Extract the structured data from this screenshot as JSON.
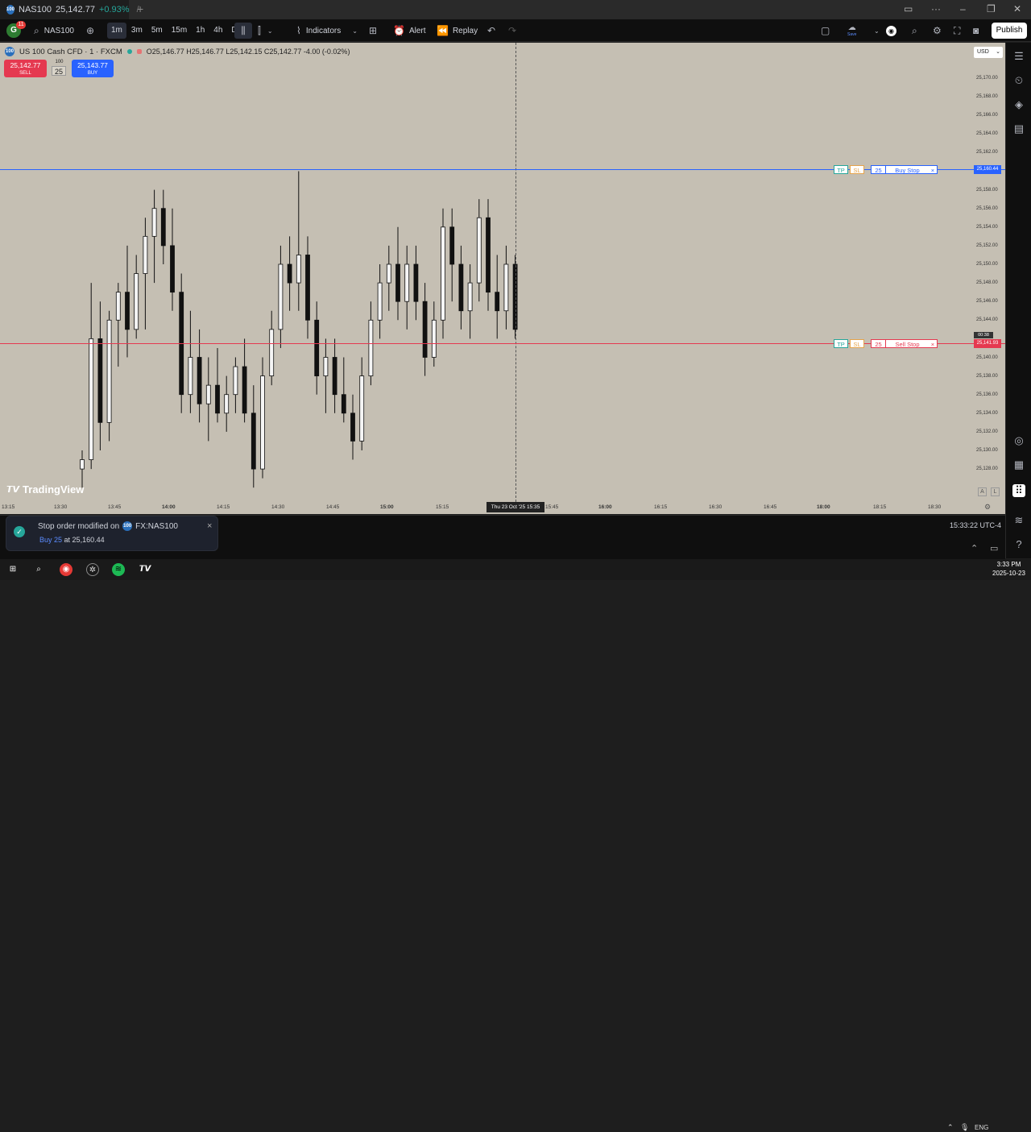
{
  "tab": {
    "symbol": "NAS100",
    "price": "25,142.77",
    "change": "+0.93%",
    "close": "/",
    "logo": "100",
    "new_tab": "+"
  },
  "toolbar": {
    "avatar_letter": "G",
    "avatar_badge": "11",
    "symbol": "NAS100",
    "intervals": [
      "1m",
      "3m",
      "5m",
      "15m",
      "1h",
      "4h",
      "D"
    ],
    "indicators_label": "Indicators",
    "alert_label": "Alert",
    "replay_label": "Replay",
    "save_label": "Save",
    "publish_label": "Publish"
  },
  "legend": {
    "title": "US 100 Cash CFD · 1 · FXCM",
    "ohlc": "O25,146.77 H25,146.77 L25,142.15 C25,142.77 -4.00 (-0.02%)"
  },
  "trade": {
    "sell_price": "25,142.77",
    "sell_label": "SELL",
    "buy_price": "25,143.77",
    "buy_label": "BUY",
    "spread": "100",
    "quantity": "25"
  },
  "currency": "USD",
  "orders": {
    "buy_stop": {
      "tp": "TP",
      "sl": "SL",
      "qty": "25",
      "label": "Buy Stop",
      "close": "×",
      "price_tag": "25,160.44",
      "color": "#2962ff"
    },
    "sell_stop": {
      "tp": "TP",
      "sl": "SL",
      "qty": "25",
      "label": "Sell Stop",
      "close": "×",
      "price_tag": "25,141.93",
      "countdown": "00:38",
      "color": "#e53950"
    }
  },
  "price_axis": {
    "labels": [
      "25,170.00",
      "25,168.00",
      "25,166.00",
      "25,164.00",
      "25,162.00",
      "25,158.00",
      "25,156.00",
      "25,154.00",
      "25,152.00",
      "25,150.00",
      "25,148.00",
      "25,146.00",
      "25,144.00",
      "25,140.00",
      "25,138.00",
      "25,136.00",
      "25,134.00",
      "25,132.00",
      "25,130.00",
      "25,128.00"
    ]
  },
  "time_axis": {
    "labels": [
      "13:15",
      "13:30",
      "13:45",
      "14:00",
      "14:15",
      "14:30",
      "14:45",
      "15:00",
      "15:15",
      "15:45",
      "16:00",
      "16:15",
      "16:30",
      "16:45",
      "18:00",
      "18:15",
      "18:30"
    ],
    "crosshair": "Thu 23 Oct '25  15:35"
  },
  "watermark": "TradingView",
  "status_clock": "15:33:22 UTC-4",
  "toast": {
    "title": "Stop order modified on",
    "symbol": "FX:NAS100",
    "side_qty": "Buy 25",
    "detail": "at 25,160.44",
    "close": "×"
  },
  "taskbar": {
    "lang": "ENG",
    "time": "3:33 PM",
    "date": "2025-10-23"
  },
  "chart_data": {
    "type": "candlestick",
    "symbol": "US 100 Cash CFD",
    "ylim": [
      25126,
      25172
    ],
    "candles": [
      {
        "o": 25128,
        "h": 25130,
        "l": 25126,
        "c": 25129
      },
      {
        "o": 25129,
        "h": 25148,
        "l": 25128,
        "c": 25142
      },
      {
        "o": 25142,
        "h": 25146,
        "l": 25130,
        "c": 25133
      },
      {
        "o": 25133,
        "h": 25145,
        "l": 25131,
        "c": 25144
      },
      {
        "o": 25144,
        "h": 25148,
        "l": 25139,
        "c": 25147
      },
      {
        "o": 25147,
        "h": 25152,
        "l": 25140,
        "c": 25143
      },
      {
        "o": 25143,
        "h": 25151,
        "l": 25142,
        "c": 25149
      },
      {
        "o": 25149,
        "h": 25155,
        "l": 25143,
        "c": 25153
      },
      {
        "o": 25153,
        "h": 25158,
        "l": 25148,
        "c": 25156
      },
      {
        "o": 25156,
        "h": 25158,
        "l": 25150,
        "c": 25152
      },
      {
        "o": 25152,
        "h": 25156,
        "l": 25145,
        "c": 25147
      },
      {
        "o": 25147,
        "h": 25149,
        "l": 25134,
        "c": 25136
      },
      {
        "o": 25136,
        "h": 25145,
        "l": 25134,
        "c": 25140
      },
      {
        "o": 25140,
        "h": 25143,
        "l": 25133,
        "c": 25135
      },
      {
        "o": 25135,
        "h": 25140,
        "l": 25131,
        "c": 25137
      },
      {
        "o": 25137,
        "h": 25141,
        "l": 25133,
        "c": 25134
      },
      {
        "o": 25134,
        "h": 25138,
        "l": 25132,
        "c": 25136
      },
      {
        "o": 25136,
        "h": 25140,
        "l": 25134,
        "c": 25139
      },
      {
        "o": 25139,
        "h": 25142,
        "l": 25133,
        "c": 25134
      },
      {
        "o": 25134,
        "h": 25137,
        "l": 25126,
        "c": 25128
      },
      {
        "o": 25128,
        "h": 25140,
        "l": 25127,
        "c": 25138
      },
      {
        "o": 25138,
        "h": 25145,
        "l": 25137,
        "c": 25143
      },
      {
        "o": 25143,
        "h": 25152,
        "l": 25141,
        "c": 25150
      },
      {
        "o": 25150,
        "h": 25153,
        "l": 25145,
        "c": 25148
      },
      {
        "o": 25148,
        "h": 25160,
        "l": 25145,
        "c": 25151
      },
      {
        "o": 25151,
        "h": 25153,
        "l": 25142,
        "c": 25144
      },
      {
        "o": 25144,
        "h": 25146,
        "l": 25136,
        "c": 25138
      },
      {
        "o": 25138,
        "h": 25142,
        "l": 25134,
        "c": 25140
      },
      {
        "o": 25140,
        "h": 25142,
        "l": 25134,
        "c": 25136
      },
      {
        "o": 25136,
        "h": 25140,
        "l": 25133,
        "c": 25134
      },
      {
        "o": 25134,
        "h": 25136,
        "l": 25129,
        "c": 25131
      },
      {
        "o": 25131,
        "h": 25140,
        "l": 25130,
        "c": 25138
      },
      {
        "o": 25138,
        "h": 25146,
        "l": 25137,
        "c": 25144
      },
      {
        "o": 25144,
        "h": 25150,
        "l": 25142,
        "c": 25148
      },
      {
        "o": 25148,
        "h": 25152,
        "l": 25145,
        "c": 25150
      },
      {
        "o": 25150,
        "h": 25154,
        "l": 25144,
        "c": 25146
      },
      {
        "o": 25146,
        "h": 25152,
        "l": 25143,
        "c": 25150
      },
      {
        "o": 25150,
        "h": 25152,
        "l": 25144,
        "c": 25146
      },
      {
        "o": 25146,
        "h": 25148,
        "l": 25138,
        "c": 25140
      },
      {
        "o": 25140,
        "h": 25146,
        "l": 25139,
        "c": 25144
      },
      {
        "o": 25144,
        "h": 25156,
        "l": 25142,
        "c": 25154
      },
      {
        "o": 25154,
        "h": 25156,
        "l": 25146,
        "c": 25150
      },
      {
        "o": 25150,
        "h": 25152,
        "l": 25143,
        "c": 25145
      },
      {
        "o": 25145,
        "h": 25150,
        "l": 25142,
        "c": 25148
      },
      {
        "o": 25148,
        "h": 25157,
        "l": 25146,
        "c": 25155
      },
      {
        "o": 25155,
        "h": 25157,
        "l": 25145,
        "c": 25147
      },
      {
        "o": 25147,
        "h": 25151,
        "l": 25142,
        "c": 25145
      },
      {
        "o": 25145,
        "h": 25152,
        "l": 25143,
        "c": 25150
      },
      {
        "o": 25150,
        "h": 25151,
        "l": 25142,
        "c": 25143
      }
    ]
  }
}
